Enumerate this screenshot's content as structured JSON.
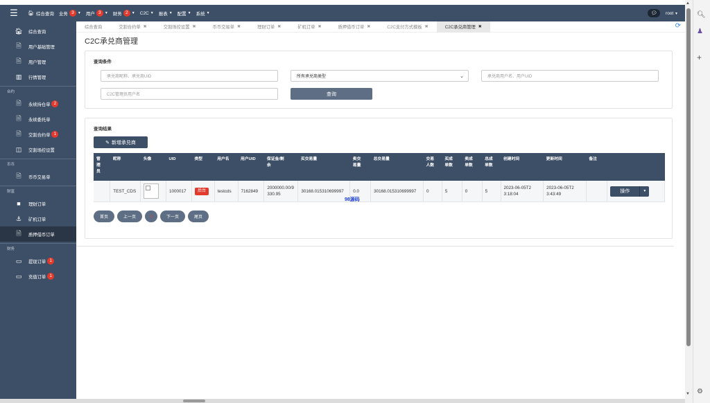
{
  "topnav": {
    "items": [
      {
        "label": "综合查询",
        "badge": "",
        "caret": false
      },
      {
        "label": "业务",
        "badge": "3",
        "caret": true
      },
      {
        "label": "用户",
        "badge": "3",
        "caret": true
      },
      {
        "label": "财务",
        "badge": "2",
        "caret": true
      },
      {
        "label": "C2C",
        "badge": "",
        "caret": true
      },
      {
        "label": "报表",
        "badge": "",
        "caret": true
      },
      {
        "label": "配置",
        "badge": "",
        "caret": true
      },
      {
        "label": "系统",
        "badge": "",
        "caret": true
      }
    ],
    "user": "root"
  },
  "sidebar": {
    "group1": [
      {
        "label": "综合查询",
        "icon": "home-icon"
      },
      {
        "label": "用户基础管理",
        "icon": "document-icon"
      },
      {
        "label": "用户管理",
        "icon": "document-icon"
      },
      {
        "label": "行情管理",
        "icon": "bar-chart-icon"
      }
    ],
    "section_contract": "合约",
    "group2": [
      {
        "label": "永续持仓单",
        "badge": "2",
        "icon": "document-icon"
      },
      {
        "label": "永续委托单",
        "badge": "",
        "icon": "document-icon"
      },
      {
        "label": "交割合约单",
        "badge": "1",
        "icon": "document-icon"
      },
      {
        "label": "交割场控设置",
        "badge": "",
        "icon": "columns-icon"
      }
    ],
    "section_coin": "币币",
    "group3": [
      {
        "label": "币币交易单",
        "icon": "document-icon"
      }
    ],
    "section_finance1": "财富",
    "group4": [
      {
        "label": "理财订单",
        "icon": "folder-icon"
      },
      {
        "label": "矿机订单",
        "icon": "anchor-icon"
      },
      {
        "label": "质押借币订单",
        "icon": "document-icon"
      }
    ],
    "section_finance2": "财务",
    "group5": [
      {
        "label": "提现订单",
        "badge": "1",
        "icon": "card-icon"
      },
      {
        "label": "充值订单",
        "badge": "1",
        "icon": "card-icon"
      }
    ]
  },
  "tabs": [
    {
      "label": "综合查询",
      "close": false
    },
    {
      "label": "交割合约单",
      "close": true
    },
    {
      "label": "交割场控设置",
      "close": true
    },
    {
      "label": "币币交易单",
      "close": true
    },
    {
      "label": "理财订单",
      "close": true
    },
    {
      "label": "矿机订单",
      "close": true
    },
    {
      "label": "质押借币订单",
      "close": true
    },
    {
      "label": "C2C支付方式模板",
      "close": true
    },
    {
      "label": "C2C承兑商管理",
      "close": true
    }
  ],
  "page_title": "C2C承兑商管理",
  "query": {
    "title": "查询条件",
    "ph_name_uid": "承兑商昵称、承兑商UID",
    "select_value": "所有承兑商类型",
    "ph_username": "承兑商用户名、用户UID",
    "ph_c2c_manager": "C2C管理员用户名",
    "button": "查询"
  },
  "results": {
    "title": "查询结果",
    "add_button": "新增承兑商",
    "columns": [
      "管理员",
      "昵称",
      "头像",
      "UID",
      "类型",
      "用户名",
      "用户UID",
      "保证金/剩余",
      "买交易量",
      "卖交易量",
      "总交易量",
      "交易人数",
      "买成单数",
      "卖成单数",
      "总成单数",
      "创建时间",
      "更新时间",
      "备注"
    ],
    "rows": [
      {
        "admin": "",
        "nickname": "TEST_CDS",
        "uid": "1000017",
        "type": "后台",
        "username": "testcds",
        "user_uid": "7162849",
        "margin": "2000000.00/9330.95",
        "buy_volume": "30168.015310699997",
        "sell_volume": "0.0",
        "total_volume": "30168.015310699997",
        "traders": "0",
        "buy_orders": "5",
        "sell_orders": "0",
        "total_orders": "5",
        "created": "2023-06-05T23:18:04",
        "updated": "2023-06-05T23:43:49",
        "note": "",
        "action": "操作"
      }
    ],
    "watermark": "98源码"
  },
  "pager": {
    "first": "首页",
    "prev": "上一页",
    "current": "1",
    "next": "下一页",
    "last": "尾页"
  }
}
